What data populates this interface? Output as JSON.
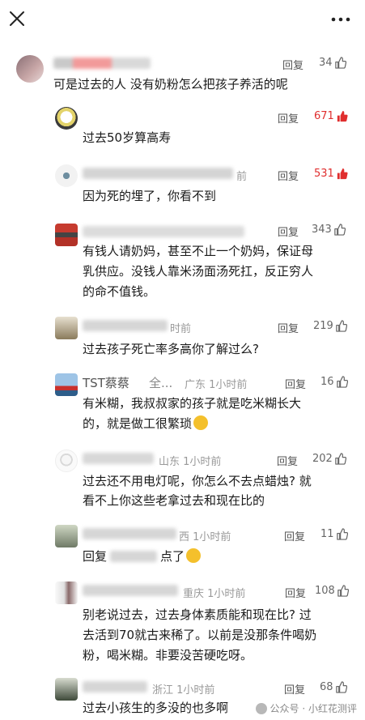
{
  "header": {
    "close_icon": "close-icon",
    "more_icon": "more-dots-icon"
  },
  "reply_label": "回复",
  "comments": [
    {
      "time": "",
      "likes": "34",
      "hot": false,
      "text": "可是过去的人 没有奶粉怎么把孩子养活的呢"
    },
    {
      "time": "",
      "likes": "671",
      "hot": true,
      "text": "过去50岁算高寿"
    },
    {
      "time": "前",
      "likes": "531",
      "hot": true,
      "text": "因为死的埋了，你看不到"
    },
    {
      "time": "",
      "likes": "343",
      "hot": false,
      "text_lines": [
        "有钱人请奶妈，甚至不止一个奶妈，保证母",
        "乳供应。没钱人靠米汤面汤死扛，反正穷人",
        "的命不值钱。"
      ]
    },
    {
      "time": "时前",
      "likes": "219",
      "hot": false,
      "text": "过去孩子死亡率多高你了解过么?"
    },
    {
      "user": "TST蔡蔡",
      "user_suffix": "全...",
      "time": "广东 1小时前",
      "likes": "16",
      "hot": false,
      "text_lines": [
        "有米糊，我叔叔家的孩子就是吃米糊长大",
        "的，就是做工很繁琐"
      ]
    },
    {
      "time": "山东 1小时前",
      "likes": "202",
      "hot": false,
      "text_lines": [
        "过去还不用电灯呢，你怎么不去点蜡烛? 就",
        "看不上你这些老拿过去和现在比的"
      ]
    },
    {
      "time": "西 1小时前",
      "likes": "11",
      "hot": false,
      "text_prefix": "回复",
      "text_suffix": "点了"
    },
    {
      "time": "重庆 1小时前",
      "likes": "108",
      "hot": false,
      "text_lines": [
        "别老说过去，过去身体素质能和现在比? 过",
        "去活到70就古来稀了。以前是没那条件喝奶",
        "粉，喝米糊。非要没苦硬吃呀。"
      ]
    },
    {
      "time": "浙江 1小时前",
      "likes": "68",
      "hot": false,
      "text": "过去小孩生的多没的也多啊"
    }
  ],
  "watermark": "公众号 · 小红花测评",
  "colors": {
    "hot_likes": "#e02e2e",
    "text": "#1a1a1a",
    "meta": "#999999"
  }
}
